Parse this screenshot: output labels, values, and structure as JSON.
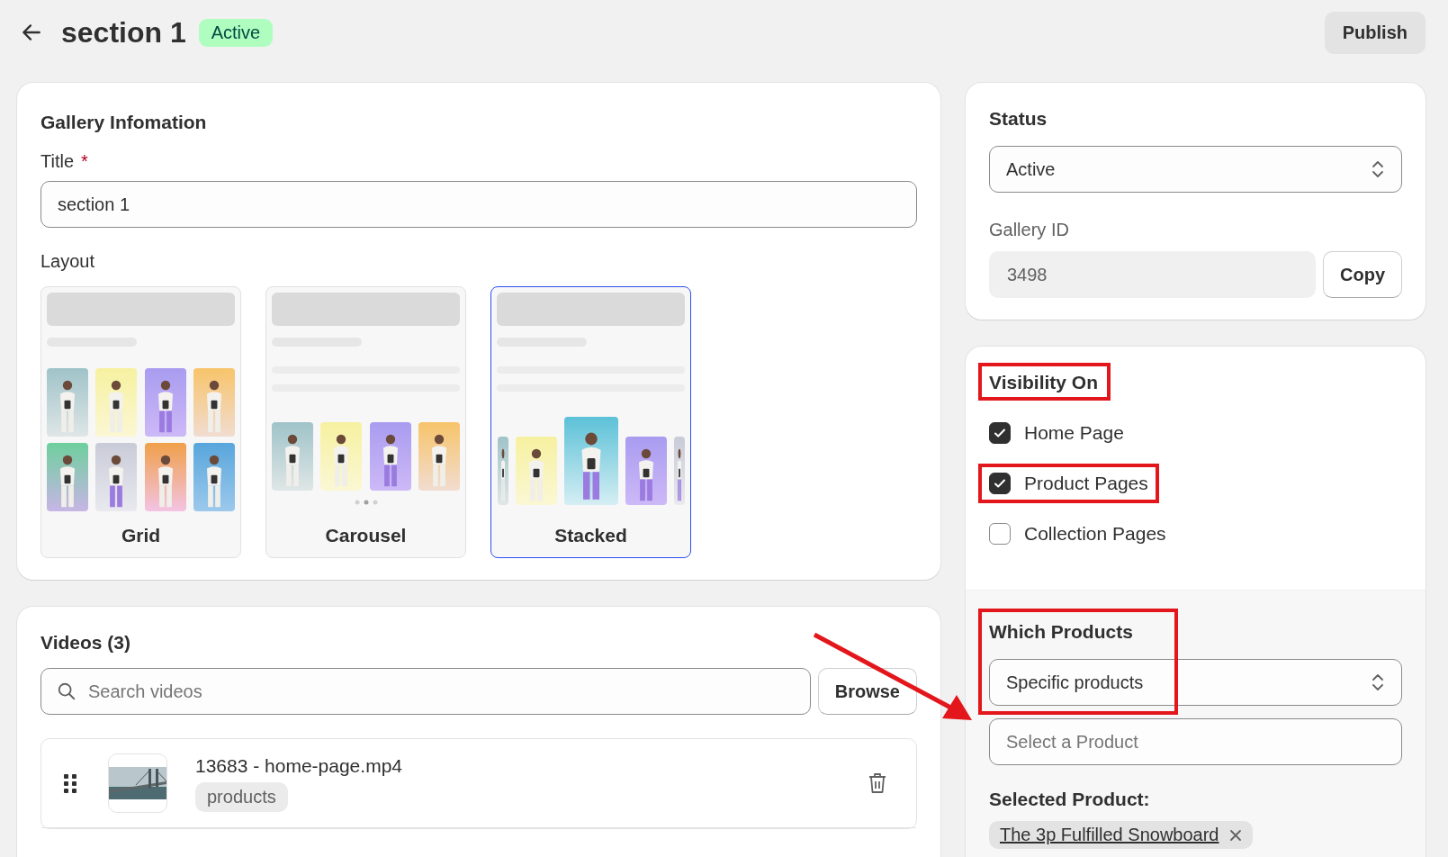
{
  "header": {
    "title": "section 1",
    "badge": "Active",
    "publish": "Publish"
  },
  "gallery": {
    "heading": "Gallery Infomation",
    "title_label": "Title",
    "required_mark": "*",
    "title_value": "section 1",
    "layout_label": "Layout",
    "layouts": [
      {
        "label": "Grid",
        "kind": "grid",
        "selected": false
      },
      {
        "label": "Carousel",
        "kind": "carousel",
        "selected": false
      },
      {
        "label": "Stacked",
        "kind": "stacked",
        "selected": true
      }
    ]
  },
  "videos": {
    "heading": "Videos (3)",
    "search_placeholder": "Search videos",
    "browse": "Browse",
    "items": [
      {
        "name": "13683 - home-page.mp4",
        "tag": "products"
      }
    ]
  },
  "status": {
    "heading": "Status",
    "value": "Active",
    "id_label": "Gallery ID",
    "id_value": "3498",
    "copy": "Copy"
  },
  "visibility": {
    "heading": "Visibility On",
    "highlighted": true,
    "options": [
      {
        "label": "Home Page",
        "checked": true,
        "highlighted": false
      },
      {
        "label": "Product Pages",
        "checked": true,
        "highlighted": true
      },
      {
        "label": "Collection Pages",
        "checked": false,
        "highlighted": false
      }
    ]
  },
  "which": {
    "heading": "Which Products",
    "highlighted": true,
    "value": "Specific products",
    "product_placeholder": "Select a Product",
    "selected_label": "Selected Product:",
    "selected": [
      {
        "label": "The 3p Fulfilled Snowboard"
      }
    ]
  }
}
